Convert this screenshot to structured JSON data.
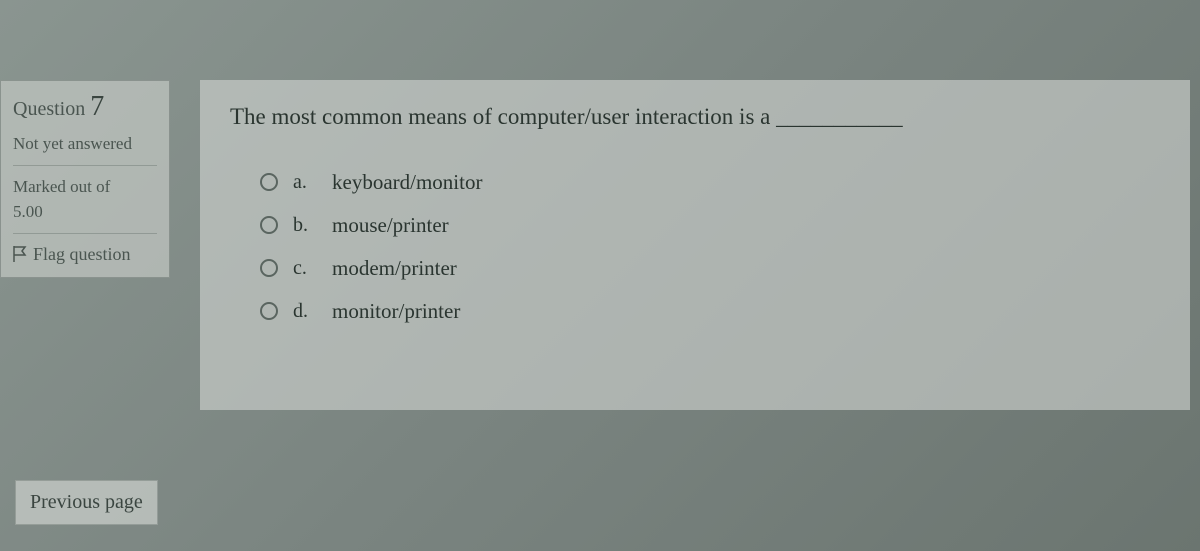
{
  "sidebar": {
    "question_label": "Question",
    "question_number": "7",
    "status": "Not yet answered",
    "marked_label": "Marked out of",
    "marked_value": "5.00",
    "flag_label": "Flag question"
  },
  "question": {
    "text": "The most common means of computer/user interaction is a ___________",
    "options": [
      {
        "letter": "a.",
        "text": "keyboard/monitor"
      },
      {
        "letter": "b.",
        "text": "mouse/printer"
      },
      {
        "letter": "c.",
        "text": "modem/printer"
      },
      {
        "letter": "d.",
        "text": "monitor/printer"
      }
    ]
  },
  "nav": {
    "previous": "Previous page"
  }
}
